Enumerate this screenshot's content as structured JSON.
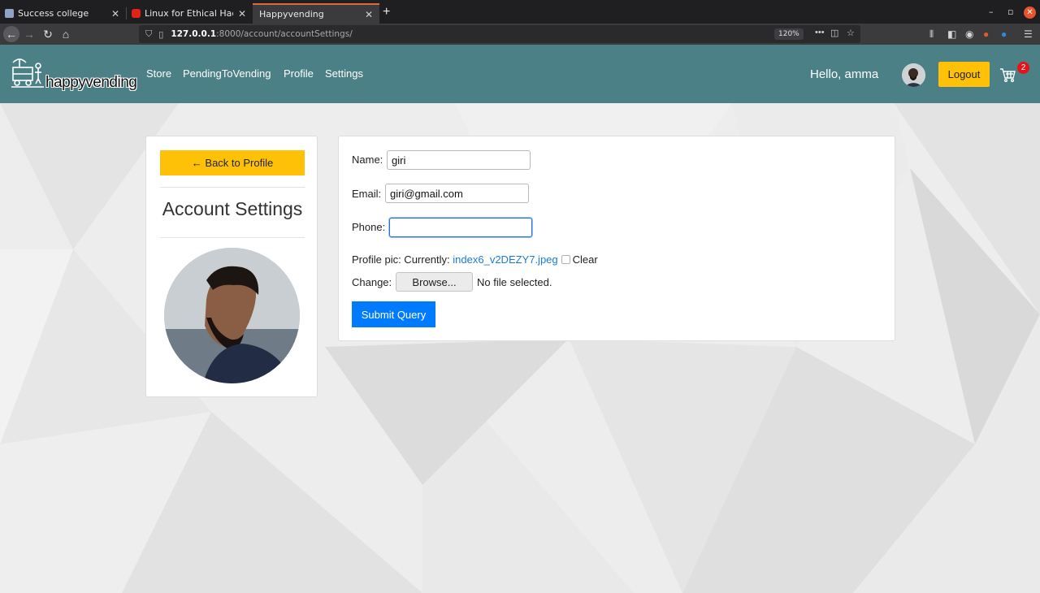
{
  "browser": {
    "tabs": [
      {
        "title": "Success college",
        "icon": "college-favicon-icon"
      },
      {
        "title": "Linux for Ethical Hackers",
        "icon": "youtube-favicon-icon"
      },
      {
        "title": "Happyvending",
        "icon": "none",
        "active": true
      }
    ],
    "url_host": "127.0.0.1",
    "url_rest": ":8000/account/accountSettings/",
    "zoom": "120%"
  },
  "header": {
    "logo_text": "happyvending",
    "nav": [
      "Store",
      "PendingToVending",
      "Profile",
      "Settings"
    ],
    "greeting": "Hello, amma",
    "logout_label": "Logout",
    "cart_count": "2",
    "brand_color": "#4a8086",
    "accent_color": "#ffc107"
  },
  "sidebar": {
    "back_label": "← Back to Profile",
    "title": "Account Settings"
  },
  "form": {
    "name_label": "Name:",
    "name_value": "giri",
    "email_label": "Email:",
    "email_value": "giri@gmail.com",
    "phone_label": "Phone:",
    "phone_value": "",
    "pic_label": "Profile pic: Currently:",
    "pic_file": "index6_v2DEZY7.jpeg",
    "clear_label": "Clear",
    "change_label": "Change:",
    "browse_label": "Browse...",
    "no_file_label": "No file selected.",
    "submit_label": "Submit Query",
    "submit_color": "#007bff"
  }
}
